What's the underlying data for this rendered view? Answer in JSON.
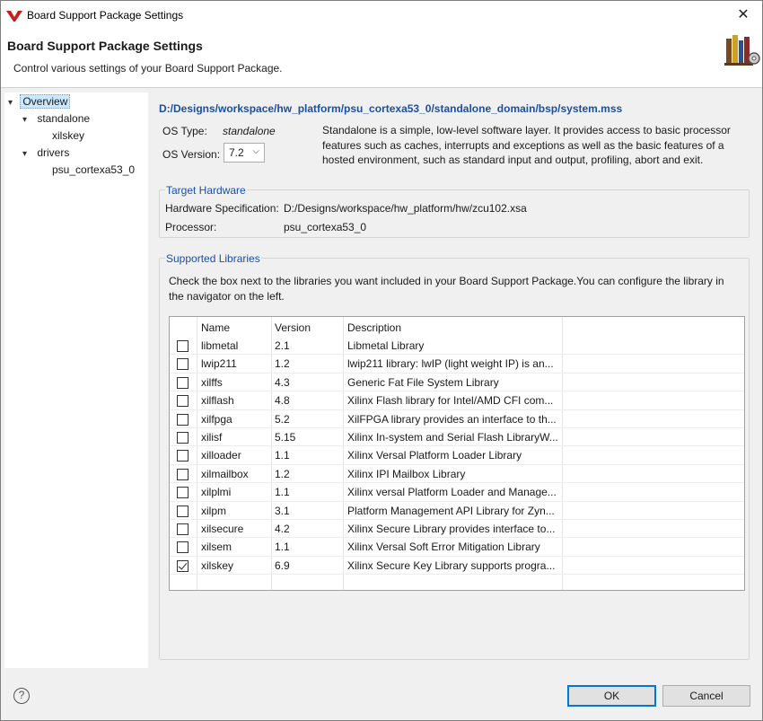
{
  "window": {
    "title": "Board Support Package Settings",
    "close_glyph": "✕"
  },
  "header": {
    "title": "Board Support Package Settings",
    "subtitle": "Control various settings of your Board Support Package.",
    "icon": "books-gear-icon"
  },
  "nav": {
    "items": [
      {
        "label": "Overview",
        "selected": true
      },
      {
        "label": "standalone"
      },
      {
        "label": "xilskey"
      },
      {
        "label": "drivers"
      },
      {
        "label": "psu_cortexa53_0"
      }
    ]
  },
  "overview": {
    "path": "D:/Designs/workspace/hw_platform/psu_cortexa53_0/standalone_domain/bsp/system.mss",
    "os_type_label": "OS Type:",
    "os_type_value": "standalone",
    "os_version_label": "OS Version:",
    "os_version_value": "7.2",
    "os_description": "Standalone is a simple, low-level software layer. It provides access to basic processor features such as caches, interrupts and exceptions as well as the basic features of a hosted environment, such as standard input and output, profiling, abort and exit."
  },
  "target_hardware": {
    "legend": "Target Hardware",
    "hw_spec_label": "Hardware Specification:",
    "hw_spec_value": "D:/Designs/workspace/hw_platform/hw/zcu102.xsa",
    "processor_label": "Processor:",
    "processor_value": "psu_cortexa53_0"
  },
  "libraries": {
    "legend": "Supported Libraries",
    "instructions": "Check the box next to the libraries you want included in your Board Support Package.You can configure the library in the navigator on the left.",
    "columns": [
      "Name",
      "Version",
      "Description"
    ],
    "rows": [
      {
        "checked": false,
        "name": "libmetal",
        "version": "2.1",
        "description": "Libmetal Library"
      },
      {
        "checked": false,
        "name": "lwip211",
        "version": "1.2",
        "description": "lwip211 library: lwIP (light weight IP) is an..."
      },
      {
        "checked": false,
        "name": "xilffs",
        "version": "4.3",
        "description": "Generic Fat File System Library"
      },
      {
        "checked": false,
        "name": "xilflash",
        "version": "4.8",
        "description": "Xilinx Flash library for Intel/AMD CFI com..."
      },
      {
        "checked": false,
        "name": "xilfpga",
        "version": "5.2",
        "description": "XilFPGA library provides an interface to th..."
      },
      {
        "checked": false,
        "name": "xilisf",
        "version": "5.15",
        "description": "Xilinx In-system and Serial Flash LibraryW..."
      },
      {
        "checked": false,
        "name": "xilloader",
        "version": "1.1",
        "description": "Xilinx Versal Platform Loader Library"
      },
      {
        "checked": false,
        "name": "xilmailbox",
        "version": "1.2",
        "description": "Xilinx IPI Mailbox Library"
      },
      {
        "checked": false,
        "name": "xilplmi",
        "version": "1.1",
        "description": "Xilinx versal Platform Loader and Manage..."
      },
      {
        "checked": false,
        "name": "xilpm",
        "version": "3.1",
        "description": "Platform Management API Library for Zyn..."
      },
      {
        "checked": false,
        "name": "xilsecure",
        "version": "4.2",
        "description": "Xilinx Secure Library provides interface to..."
      },
      {
        "checked": false,
        "name": "xilsem",
        "version": "1.1",
        "description": "Xilinx Versal Soft Error Mitigation Library"
      },
      {
        "checked": true,
        "name": "xilskey",
        "version": "6.9",
        "description": "Xilinx Secure Key Library supports progra..."
      }
    ]
  },
  "footer": {
    "help_glyph": "?",
    "ok_label": "OK",
    "cancel_label": "Cancel"
  },
  "colors": {
    "accent": "#1a4fa3",
    "selection": "#cce8ff",
    "default_button_border": "#0078d7"
  }
}
